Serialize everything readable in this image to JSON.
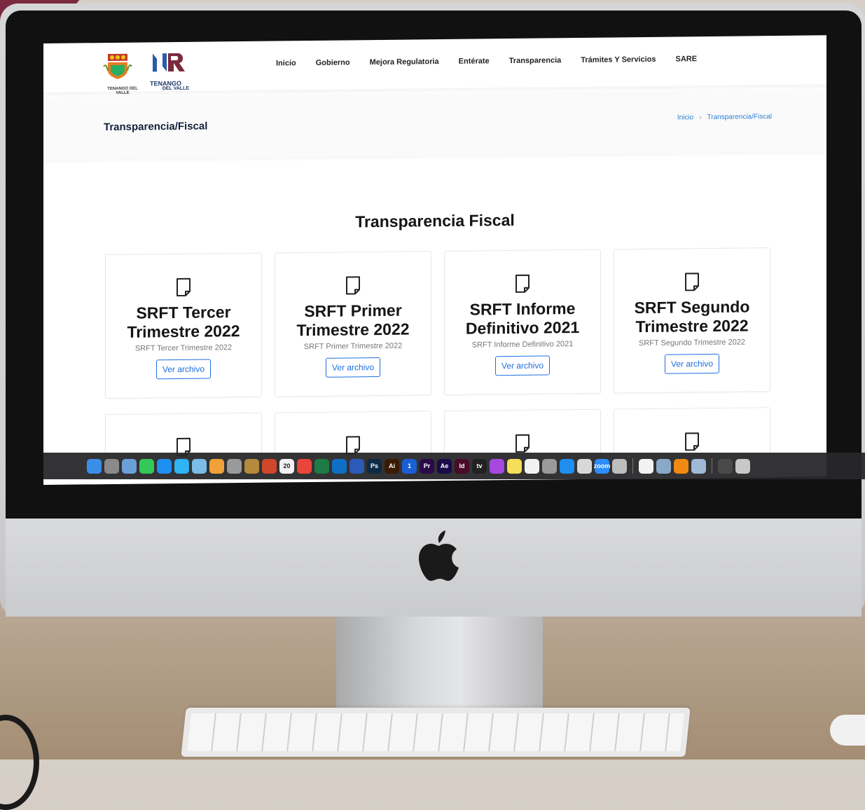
{
  "brand": {
    "municipality_logo_text": "TENANGO DEL VALLE",
    "nr_logo_line1": "TENANGO",
    "nr_logo_line2": "DEL VALLE",
    "accent": "#7a2a3e",
    "link": "#1f6fe0"
  },
  "nav": {
    "items": [
      "Inicio",
      "Gobierno",
      "Mejora Regulatoria",
      "Entérate",
      "Transparencia",
      "Trámites Y Servicios",
      "SARE"
    ]
  },
  "header": {
    "title": "Transparencia/Fiscal",
    "breadcrumb": [
      "Inicio",
      "Transparencia/Fiscal"
    ]
  },
  "main": {
    "section_title": "Transparencia Fiscal",
    "cards": [
      {
        "title": "SRFT Tercer Trimestre 2022",
        "subtitle": "SRFT Tercer Trimestre 2022",
        "button": "Ver archivo"
      },
      {
        "title": "SRFT Primer Trimestre 2022",
        "subtitle": "SRFT Primer Trimestre 2022",
        "button": "Ver archivo"
      },
      {
        "title": "SRFT Informe Definitivo 2021",
        "subtitle": "SRFT Informe Definitivo 2021",
        "button": "Ver archivo"
      },
      {
        "title": "SRFT Segundo Trimestre 2022",
        "subtitle": "SRFT Segundo Trimestre 2022",
        "button": "Ver archivo"
      }
    ]
  },
  "dock": {
    "apps": [
      {
        "icon": "finder-icon",
        "label": "",
        "color": "#3b8ee8"
      },
      {
        "icon": "system-preferences-icon",
        "label": "",
        "color": "#8a8a8a"
      },
      {
        "icon": "preview-icon",
        "label": "",
        "color": "#6aa0d8"
      },
      {
        "icon": "facetime-icon",
        "label": "",
        "color": "#35c759"
      },
      {
        "icon": "safari-icon",
        "label": "",
        "color": "#1e8ef0"
      },
      {
        "icon": "messages-icon",
        "label": "",
        "color": "#2fb3f5"
      },
      {
        "icon": "image-capture-icon",
        "label": "",
        "color": "#7bbde6"
      },
      {
        "icon": "photos-icon",
        "label": "",
        "color": "#f0a13a"
      },
      {
        "icon": "launchpad-icon",
        "label": "",
        "color": "#9a9a9a"
      },
      {
        "icon": "notes-book-icon",
        "label": "",
        "color": "#b58a3c"
      },
      {
        "icon": "powerpoint-icon",
        "label": "",
        "color": "#d0472c"
      },
      {
        "icon": "calendar-icon",
        "label": "20",
        "color": "#f2f2f2"
      },
      {
        "icon": "chrome-icon",
        "label": "",
        "color": "#e9453a"
      },
      {
        "icon": "excel-icon",
        "label": "",
        "color": "#1e7b45"
      },
      {
        "icon": "outlook-icon",
        "label": "",
        "color": "#0f6fc6"
      },
      {
        "icon": "word-icon",
        "label": "",
        "color": "#2b5ab8"
      },
      {
        "icon": "photoshop-icon",
        "label": "Ps",
        "color": "#0d2a45"
      },
      {
        "icon": "illustrator-icon",
        "label": "Ai",
        "color": "#3a1a00"
      },
      {
        "icon": "onepassword-icon",
        "label": "1",
        "color": "#1a5fd6"
      },
      {
        "icon": "premiere-icon",
        "label": "Pr",
        "color": "#2a0a4a"
      },
      {
        "icon": "after-effects-icon",
        "label": "Ae",
        "color": "#1a0a4a"
      },
      {
        "icon": "indesign-icon",
        "label": "Id",
        "color": "#4a0a2a"
      },
      {
        "icon": "apple-tv-icon",
        "label": "tv",
        "color": "#222222"
      },
      {
        "icon": "podcasts-icon",
        "label": "",
        "color": "#a548e0"
      },
      {
        "icon": "stickies-icon",
        "label": "",
        "color": "#f5de5a"
      },
      {
        "icon": "music-icon",
        "label": "",
        "color": "#f2f2f2"
      },
      {
        "icon": "keychain-icon",
        "label": "",
        "color": "#9a9a9a"
      },
      {
        "icon": "app-store-icon",
        "label": "",
        "color": "#1e8ef0"
      },
      {
        "icon": "file-icon",
        "label": "",
        "color": "#d8d8d8"
      },
      {
        "icon": "zoom-icon",
        "label": "zoom",
        "color": "#2d8cff"
      },
      {
        "icon": "printer-icon",
        "label": "",
        "color": "#bdbdbd"
      },
      {
        "icon": "wifi-icon",
        "label": "",
        "color": "#f2f2f2"
      },
      {
        "icon": "screenshot-icon",
        "label": "",
        "color": "#8aa8c8"
      },
      {
        "icon": "vlc-icon",
        "label": "",
        "color": "#f08a12"
      },
      {
        "icon": "preview-image-icon",
        "label": "",
        "color": "#9fb9d6"
      },
      {
        "icon": "document-icon",
        "label": "",
        "color": "#4a4a4a"
      },
      {
        "icon": "trash-icon",
        "label": "",
        "color": "#c8c8c8"
      }
    ]
  }
}
